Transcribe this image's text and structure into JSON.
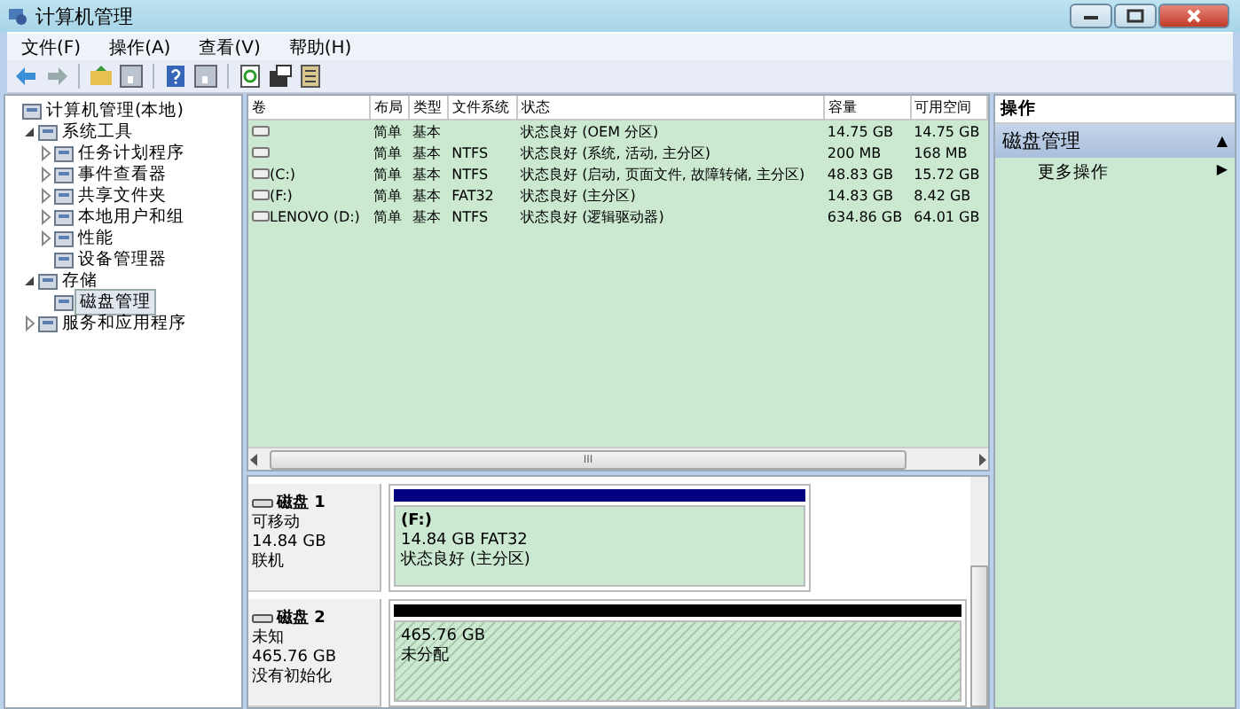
{
  "window": {
    "title": "计算机管理"
  },
  "menu": [
    "文件(F)",
    "操作(A)",
    "查看(V)",
    "帮助(H)"
  ],
  "tree": [
    {
      "label": "计算机管理(本地)",
      "selected": false,
      "children": [
        {
          "label": "系统工具",
          "selected": false,
          "expanded": true,
          "children": [
            {
              "label": "任务计划程序",
              "selected": false,
              "expanded": false
            },
            {
              "label": "事件查看器",
              "selected": false,
              "expanded": false
            },
            {
              "label": "共享文件夹",
              "selected": false,
              "expanded": false
            },
            {
              "label": "本地用户和组",
              "selected": false,
              "expanded": false
            },
            {
              "label": "性能",
              "selected": false,
              "expanded": false
            },
            {
              "label": "设备管理器",
              "selected": false
            }
          ]
        },
        {
          "label": "存储",
          "selected": false,
          "expanded": true,
          "children": [
            {
              "label": "磁盘管理",
              "selected": true
            }
          ]
        },
        {
          "label": "服务和应用程序",
          "selected": false,
          "expanded": false
        }
      ]
    }
  ],
  "table": {
    "columns": [
      "卷",
      "布局",
      "类型",
      "文件系统",
      "状态",
      "容量",
      "可用空间"
    ],
    "rows": [
      [
        "",
        "简单",
        "基本",
        "",
        "状态良好 (OEM 分区)",
        "14.75 GB",
        "14.75 GB"
      ],
      [
        "",
        "简单",
        "基本",
        "NTFS",
        "状态良好 (系统, 活动, 主分区)",
        "200 MB",
        "168 MB"
      ],
      [
        "(C:)",
        "简单",
        "基本",
        "NTFS",
        "状态良好 (启动, 页面文件, 故障转储, 主分区)",
        "48.83 GB",
        "15.72 GB"
      ],
      [
        "(F:)",
        "简单",
        "基本",
        "FAT32",
        "状态良好 (主分区)",
        "14.83 GB",
        "8.42 GB"
      ],
      [
        "LENOVO (D:)",
        "简单",
        "基本",
        "NTFS",
        "状态良好 (逻辑驱动器)",
        "634.86 GB",
        "64.01 GB"
      ]
    ]
  },
  "scrollbar_grip": "III",
  "disks": [
    {
      "name": "磁盘 1",
      "type": "可移动",
      "size": "14.84 GB",
      "status": "联机",
      "partition": {
        "kind": "primary",
        "label": "(F:)",
        "size": "14.84 GB FAT32",
        "status": "状态良好 (主分区)"
      }
    },
    {
      "name": "磁盘 2",
      "type": "未知",
      "size": "465.76 GB",
      "status": "没有初始化",
      "partition": {
        "kind": "unallocated",
        "size": "465.76 GB",
        "status": "未分配"
      }
    }
  ],
  "actions": {
    "title": "操作",
    "section": "磁盘管理",
    "section_mark": "▲",
    "items": [
      {
        "label": "更多操作",
        "mark": "▶"
      }
    ]
  }
}
